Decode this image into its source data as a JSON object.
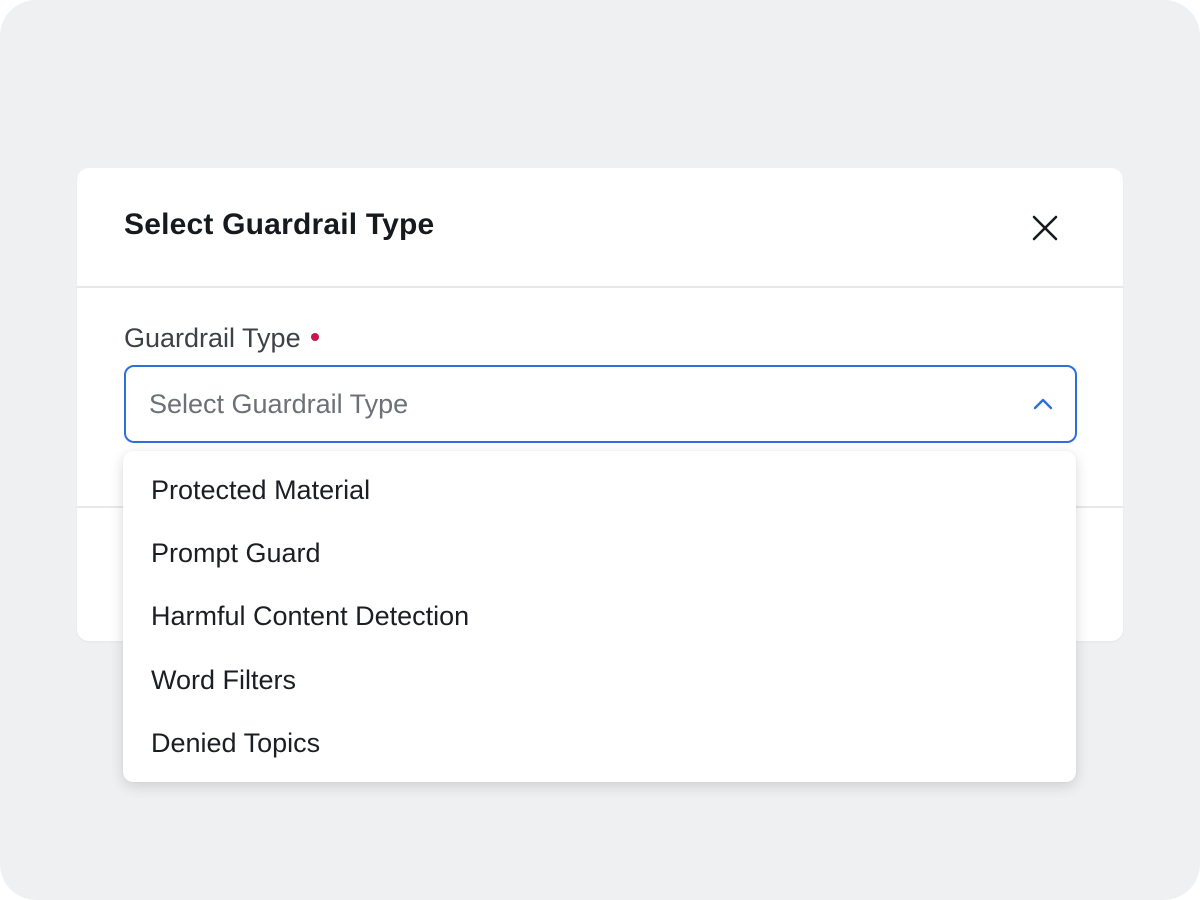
{
  "modal": {
    "title": "Select Guardrail Type",
    "close_icon": "close-icon"
  },
  "field": {
    "label": "Guardrail Type",
    "required": true,
    "required_color": "#c8164e",
    "placeholder": "Select Guardrail Type",
    "chevron_icon": "chevron-up-icon",
    "focus_color": "#2f6fdc"
  },
  "dropdown": {
    "options": [
      "Protected Material",
      "Prompt Guard",
      "Harmful Content Detection",
      "Word Filters",
      "Denied Topics"
    ]
  }
}
